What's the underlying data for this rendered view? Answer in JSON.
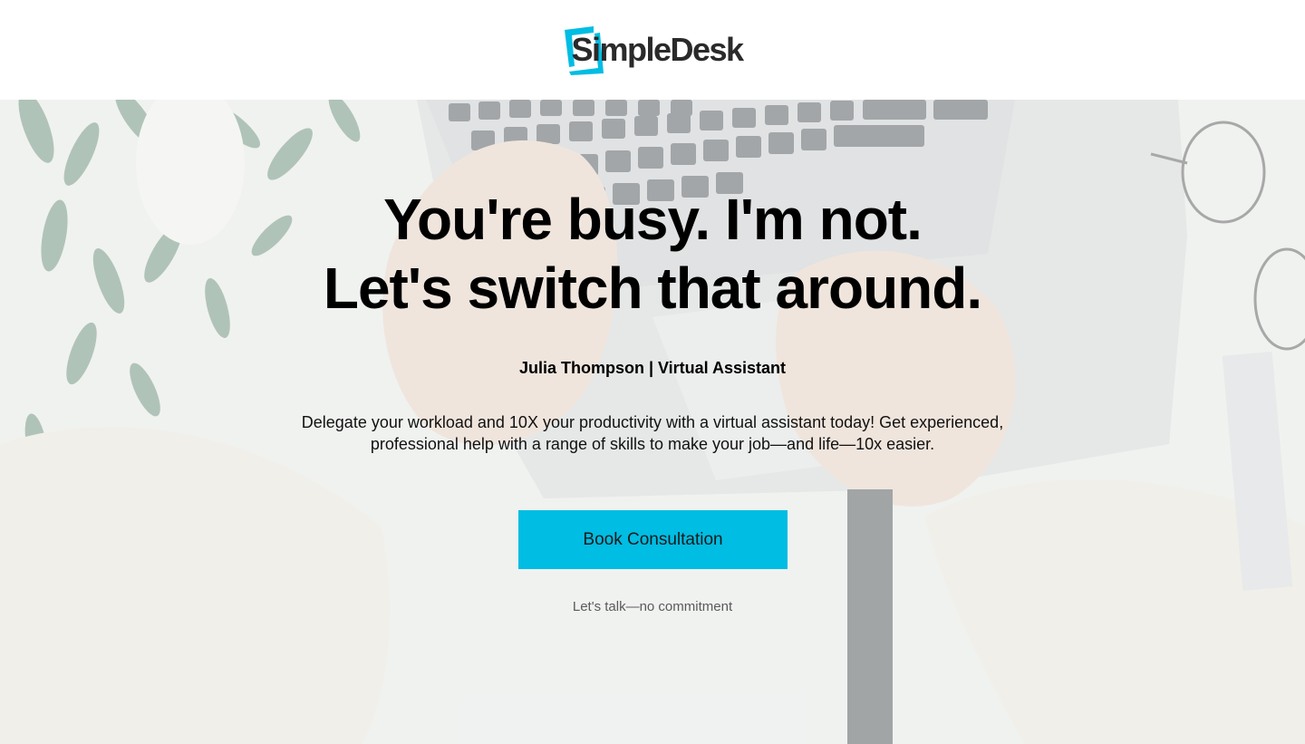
{
  "header": {
    "logo_text": "SimpleDesk",
    "logo_icon": "bracket-frame-logo-icon"
  },
  "hero": {
    "background": "laptop-hands-desk-photo",
    "headline_line1": "You're busy. I'm not.",
    "headline_line2": "Let's switch that around.",
    "byline": "Julia Thompson | Virtual Assistant",
    "description": "Delegate your workload and 10X your productivity with a virtual assistant today! Get experienced, professional help with a range of skills to make your job—and life—10x easier.",
    "cta_label": "Book Consultation",
    "cta_note": "Let's talk—no commitment"
  },
  "colors": {
    "accent": "#00bde3",
    "logo_text": "#2a2a2a",
    "background": "#ffffff"
  }
}
